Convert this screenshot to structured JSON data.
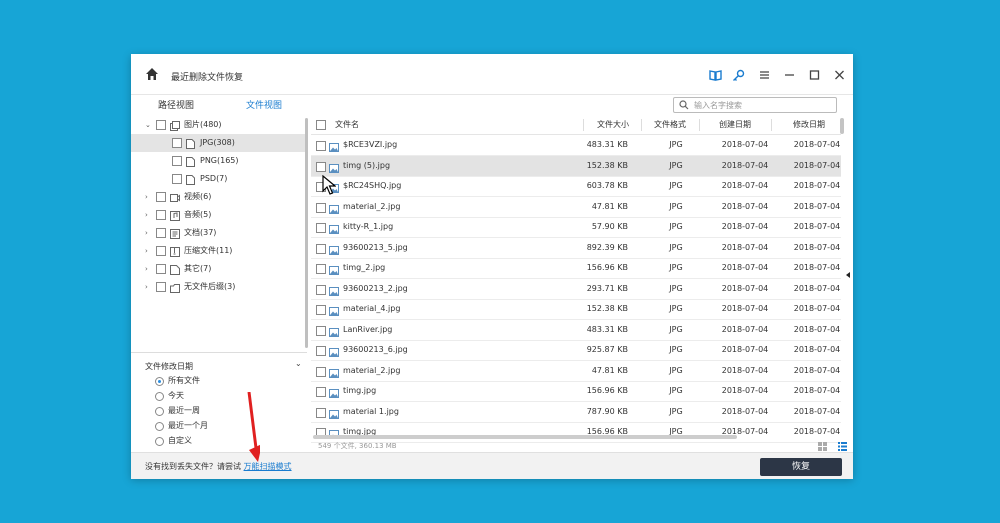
{
  "titlebar": {
    "title": "最近删除文件恢复",
    "icons": [
      "home-icon",
      "book-icon",
      "key-icon",
      "menu-icon",
      "minimize-icon",
      "maximize-icon",
      "close-icon"
    ]
  },
  "tabs": [
    {
      "label": "路径视图",
      "active": false
    },
    {
      "label": "文件视图",
      "active": true
    }
  ],
  "search": {
    "placeholder": "输入名字搜索"
  },
  "tree": [
    {
      "label": "图片(480)",
      "expanded": true,
      "level": 0,
      "icon": "images-icon"
    },
    {
      "label": "JPG(308)",
      "level": 1,
      "selected": true,
      "icon": "file-icon"
    },
    {
      "label": "PNG(165)",
      "level": 1,
      "icon": "file-icon"
    },
    {
      "label": "PSD(7)",
      "level": 1,
      "icon": "file-icon"
    },
    {
      "label": "视频(6)",
      "level": 0,
      "icon": "video-icon"
    },
    {
      "label": "音频(5)",
      "level": 0,
      "icon": "audio-icon"
    },
    {
      "label": "文档(37)",
      "level": 0,
      "icon": "document-icon"
    },
    {
      "label": "压缩文件(11)",
      "level": 0,
      "icon": "archive-icon"
    },
    {
      "label": "其它(7)",
      "level": 0,
      "icon": "other-icon"
    },
    {
      "label": "无文件后缀(3)",
      "level": 0,
      "icon": "no-extension-icon"
    }
  ],
  "filter": {
    "title": "文件修改日期",
    "options": [
      "所有文件",
      "今天",
      "最近一周",
      "最近一个月",
      "自定义"
    ],
    "selected_index": 0
  },
  "table": {
    "columns": [
      "文件名",
      "文件大小",
      "文件格式",
      "创建日期",
      "修改日期"
    ],
    "rows": [
      [
        "$RCE3VZI.jpg",
        "483.31 KB",
        "JPG",
        "2018-07-04",
        "2018-07-04"
      ],
      [
        "timg (5).jpg",
        "152.38 KB",
        "JPG",
        "2018-07-04",
        "2018-07-04"
      ],
      [
        "$RC24SHQ.jpg",
        "603.78 KB",
        "JPG",
        "2018-07-04",
        "2018-07-04"
      ],
      [
        "material_2.jpg",
        "47.81 KB",
        "JPG",
        "2018-07-04",
        "2018-07-04"
      ],
      [
        "kitty-R_1.jpg",
        "57.90 KB",
        "JPG",
        "2018-07-04",
        "2018-07-04"
      ],
      [
        "93600213_5.jpg",
        "892.39 KB",
        "JPG",
        "2018-07-04",
        "2018-07-04"
      ],
      [
        "timg_2.jpg",
        "156.96 KB",
        "JPG",
        "2018-07-04",
        "2018-07-04"
      ],
      [
        "93600213_2.jpg",
        "293.71 KB",
        "JPG",
        "2018-07-04",
        "2018-07-04"
      ],
      [
        "material_4.jpg",
        "152.38 KB",
        "JPG",
        "2018-07-04",
        "2018-07-04"
      ],
      [
        "LanRiver.jpg",
        "483.31 KB",
        "JPG",
        "2018-07-04",
        "2018-07-04"
      ],
      [
        "93600213_6.jpg",
        "925.87 KB",
        "JPG",
        "2018-07-04",
        "2018-07-04"
      ],
      [
        "material_2.jpg",
        "47.81 KB",
        "JPG",
        "2018-07-04",
        "2018-07-04"
      ],
      [
        "timg.jpg",
        "156.96 KB",
        "JPG",
        "2018-07-04",
        "2018-07-04"
      ],
      [
        "material 1.jpg",
        "787.90 KB",
        "JPG",
        "2018-07-04",
        "2018-07-04"
      ],
      [
        "timg.jpg",
        "156.96 KB",
        "JPG",
        "2018-07-04",
        "2018-07-04"
      ]
    ],
    "highlighted_row": 1,
    "summary": "549 个文件, 360.13 MB"
  },
  "footer": {
    "prompt": "没有找到丢失文件？请尝试",
    "link": "万能扫描模式",
    "recover_label": "恢复"
  },
  "colors": {
    "background": "#17a5d6",
    "accent": "#2b8de0",
    "recover_button": "#2c3646",
    "annotation_arrow": "#e02020"
  }
}
